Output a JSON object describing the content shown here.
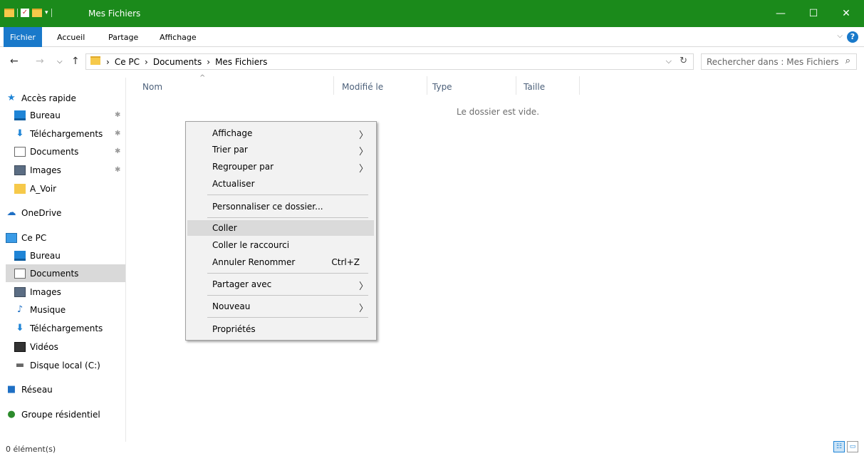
{
  "window": {
    "title": "Mes Fichiers",
    "minimize": "—",
    "maximize": "☐",
    "close": "✕",
    "accent": "#1b8a1b"
  },
  "ribbon": {
    "tabs": [
      "Fichier",
      "Accueil",
      "Partage",
      "Affichage"
    ],
    "active_tab": "Fichier",
    "help": "?",
    "collapse": "⌵"
  },
  "nav": {
    "back": "←",
    "forward": "→",
    "recent": "⌵",
    "up": "↑"
  },
  "address": {
    "lead": "›",
    "crumbs": [
      "Ce PC",
      "›",
      "Documents",
      "›",
      "Mes Fichiers"
    ],
    "dropdown": "⌵",
    "refresh": "↻"
  },
  "search": {
    "placeholder": "Rechercher dans : Mes Fichiers",
    "icon": "⌕"
  },
  "sidebar": {
    "items": [
      {
        "label": "Accès rapide",
        "icon": "star-icon",
        "glyph": "★"
      },
      {
        "label": "Bureau",
        "icon": "desktop-icon",
        "pinned": true
      },
      {
        "label": "Téléchargements",
        "icon": "download-icon",
        "glyph": "⬇",
        "pinned": true
      },
      {
        "label": "Documents",
        "icon": "document-icon",
        "pinned": true
      },
      {
        "label": "Images",
        "icon": "pictures-icon",
        "pinned": true
      },
      {
        "label": "A_Voir",
        "icon": "folder-icon"
      },
      {
        "label": "OneDrive",
        "icon": "cloud-icon",
        "glyph": "☁"
      },
      {
        "label": "Ce PC",
        "icon": "computer-icon"
      },
      {
        "label": "Bureau",
        "icon": "desktop-icon"
      },
      {
        "label": "Documents",
        "icon": "document-icon",
        "selected": true
      },
      {
        "label": "Images",
        "icon": "pictures-icon"
      },
      {
        "label": "Musique",
        "icon": "music-icon",
        "glyph": "♪"
      },
      {
        "label": "Téléchargements",
        "icon": "download-icon",
        "glyph": "⬇"
      },
      {
        "label": "Vidéos",
        "icon": "video-icon"
      },
      {
        "label": "Disque local (C:)",
        "icon": "drive-icon",
        "glyph": "▬"
      },
      {
        "label": "Réseau",
        "icon": "network-icon",
        "glyph": "■"
      },
      {
        "label": "Groupe résidentiel",
        "icon": "homegroup-icon",
        "glyph": "●"
      }
    ],
    "pin_glyph": "✱"
  },
  "columns": {
    "name": "Nom",
    "modified": "Modifié le",
    "type": "Type",
    "size": "Taille",
    "sort_glyph": "^"
  },
  "content": {
    "empty_message": "Le dossier est vide."
  },
  "context_menu": {
    "items": [
      {
        "label": "Affichage",
        "submenu": true
      },
      {
        "label": "Trier par",
        "submenu": true
      },
      {
        "label": "Regrouper par",
        "submenu": true
      },
      {
        "label": "Actualiser"
      },
      {
        "label": "Personnaliser ce dossier..."
      },
      {
        "label": "Coller",
        "highlighted": true
      },
      {
        "label": "Coller le raccourci"
      },
      {
        "label": "Annuler Renommer",
        "shortcut": "Ctrl+Z"
      },
      {
        "label": "Partager avec",
        "submenu": true
      },
      {
        "label": "Nouveau",
        "submenu": true
      },
      {
        "label": "Propriétés"
      }
    ],
    "submenu_glyph": "〉"
  },
  "status": {
    "text": "0 élément(s)"
  },
  "view_buttons": {
    "details": "☷",
    "large_icons": "▭"
  }
}
